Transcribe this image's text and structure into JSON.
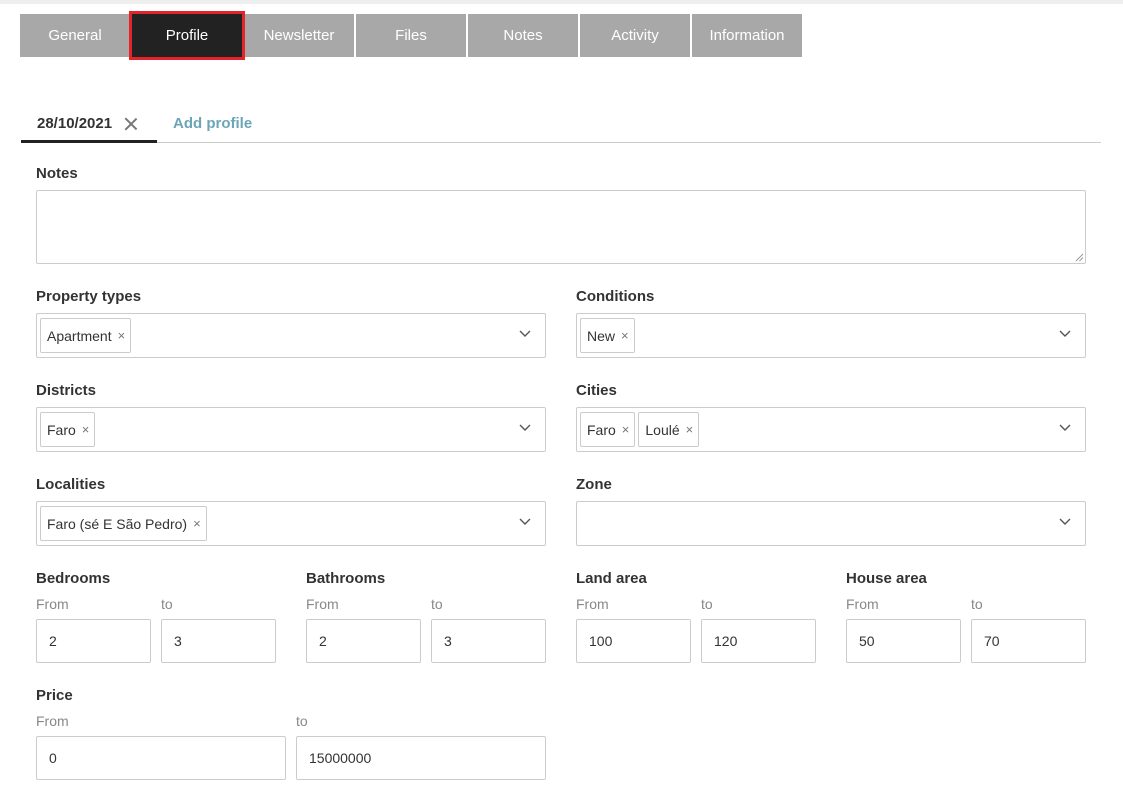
{
  "tabs": [
    {
      "label": "General",
      "active": false
    },
    {
      "label": "Profile",
      "active": true
    },
    {
      "label": "Newsletter",
      "active": false
    },
    {
      "label": "Files",
      "active": false
    },
    {
      "label": "Notes",
      "active": false
    },
    {
      "label": "Activity",
      "active": false
    },
    {
      "label": "Information",
      "active": false
    }
  ],
  "profile_tabs": {
    "current": "28/10/2021",
    "add_label": "Add profile"
  },
  "notes": {
    "label": "Notes",
    "value": ""
  },
  "property_types": {
    "label": "Property types",
    "chips": [
      "Apartment"
    ]
  },
  "conditions": {
    "label": "Conditions",
    "chips": [
      "New"
    ]
  },
  "districts": {
    "label": "Districts",
    "chips": [
      "Faro"
    ]
  },
  "cities": {
    "label": "Cities",
    "chips": [
      "Faro",
      "Loulé"
    ]
  },
  "localities": {
    "label": "Localities",
    "chips": [
      "Faro (sé E São Pedro)"
    ]
  },
  "zone": {
    "label": "Zone",
    "chips": []
  },
  "range_labels": {
    "from": "From",
    "to": "to"
  },
  "bedrooms": {
    "label": "Bedrooms",
    "from": "2",
    "to": "3"
  },
  "bathrooms": {
    "label": "Bathrooms",
    "from": "2",
    "to": "3"
  },
  "land_area": {
    "label": "Land area",
    "from": "100",
    "to": "120"
  },
  "house_area": {
    "label": "House area",
    "from": "50",
    "to": "70"
  },
  "price": {
    "label": "Price",
    "from": "0",
    "to": "15000000"
  },
  "colors": {
    "tab_inactive": "#a8a8a8",
    "tab_active": "#222222",
    "highlight": "#e3242b",
    "link": "#6aa6b8"
  },
  "icons": {
    "chip_remove": "×",
    "dropdown": "chevron-down-icon",
    "close": "close-icon"
  }
}
